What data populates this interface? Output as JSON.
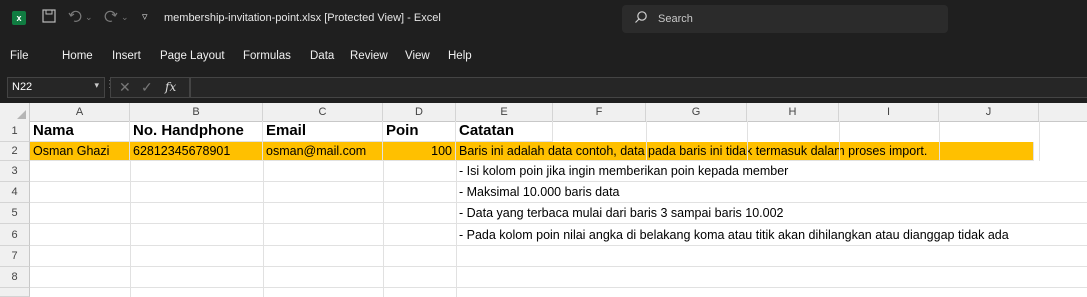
{
  "titlebar": {
    "logo": "x",
    "filename": "membership-invitation-point.xlsx",
    "mode": "[Protected View]",
    "app": "Excel",
    "search_placeholder": "Search"
  },
  "menu": [
    "File",
    "Home",
    "Insert",
    "Page Layout",
    "Formulas",
    "Data",
    "Review",
    "View",
    "Help"
  ],
  "formula_bar": {
    "cell_ref": "N22",
    "fx": "fx",
    "value": ""
  },
  "columns": [
    "A",
    "B",
    "C",
    "D",
    "E",
    "F",
    "G",
    "H",
    "I",
    "J"
  ],
  "rows": [
    "1",
    "2",
    "3",
    "4",
    "5",
    "6",
    "7",
    "8"
  ],
  "sheet": {
    "headers": {
      "a": "Nama",
      "b": "No. Handphone",
      "c": "Email",
      "d": "Poin",
      "e": "Catatan"
    },
    "sample": {
      "a": "Osman Ghazi",
      "b": "62812345678901",
      "c": "osman@mail.com",
      "d": "100",
      "e": "Baris ini adalah data contoh, data pada baris ini tidak termasuk dalam proses import."
    },
    "notes": [
      "- Isi kolom poin jika ingin memberikan poin kepada member",
      "- Maksimal 10.000 baris data",
      "- Data yang terbaca mulai dari baris 3 sampai baris 10.002",
      "- Pada kolom poin nilai angka di belakang koma atau titik akan dihilangkan atau dianggap tidak ada"
    ]
  },
  "colors": {
    "sample_row": "#ffc000",
    "excel_green": "#107c41"
  }
}
